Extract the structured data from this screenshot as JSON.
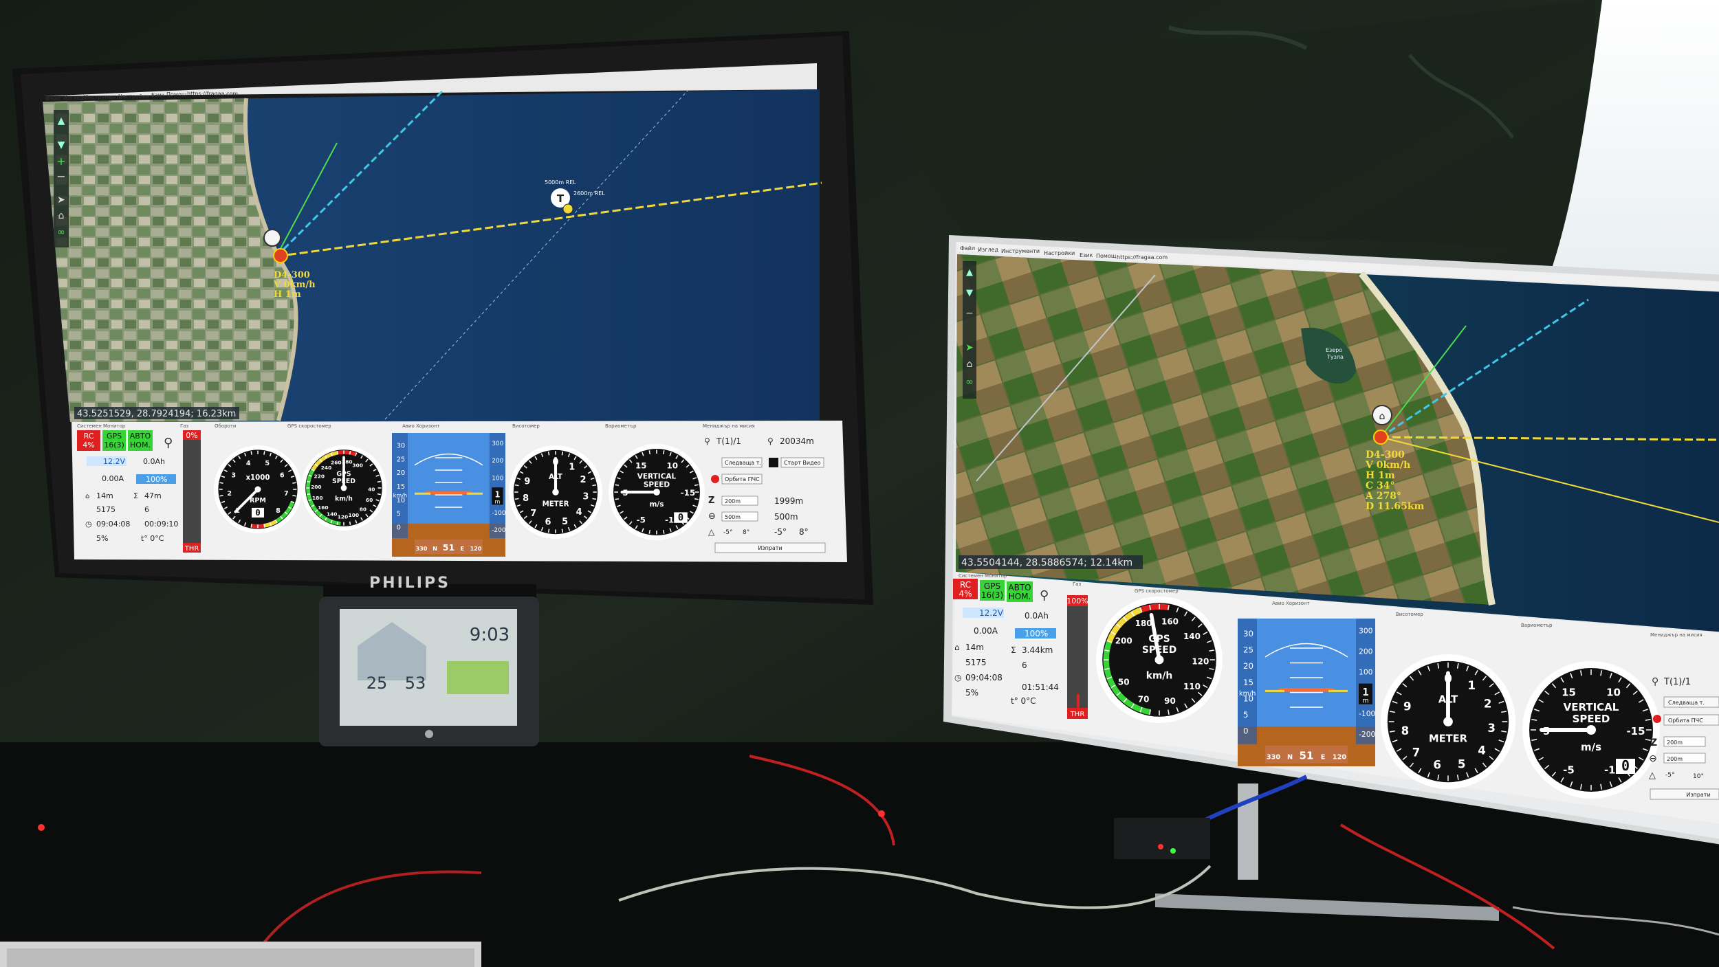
{
  "left_monitor": {
    "brand": "PHILIPS",
    "menu": [
      "Файл",
      "Изглед",
      "Инструменти",
      "Настройки",
      "Език",
      "Помощ",
      "https://fragaa.com"
    ],
    "coords": "43.5251529, 28.7924194; 16.23km",
    "waypoint_label_1": "5000m REL",
    "waypoint_label_2": "2600m REL",
    "drone_label": {
      "id": "D4-300",
      "v": "V 0km/h",
      "h": "H 1m"
    },
    "panel_titles": {
      "monitor": "Системен Монитор",
      "gas": "Газ",
      "rpm": "Обороти",
      "gps": "GPS скоростомер",
      "horizon": "Авио Хоризонт",
      "alt": "Висотомер",
      "vario": "Вариометър",
      "mission": "Мениджър на мисия"
    },
    "status": {
      "rc": [
        "RC",
        "4%"
      ],
      "gps": [
        "GPS",
        "16(3)"
      ],
      "auto": [
        "АВТО",
        "НОМ."
      ],
      "voltage": "12.2V",
      "capacity": "0.0Ah",
      "current": "0.00A",
      "battery_pct": "100%",
      "home_dist": "14m",
      "total_dist": "47m",
      "alt_total": "5175",
      "count": "6",
      "time": "09:04:08",
      "timer": "00:09:10",
      "pct": "5%",
      "temp": "t° 0°C"
    },
    "throttle": {
      "pct": "0%",
      "label": "THR"
    },
    "rpm_gauge": {
      "scale": "x1000",
      "unit": "RPM",
      "value": "0",
      "ticks": [
        "1",
        "2",
        "3",
        "4",
        "5",
        "6",
        "7",
        "8"
      ]
    },
    "gps_speed_gauge": {
      "title": "GPS\nSPEED",
      "unit": "km/h",
      "ticks": [
        "300",
        "280",
        "260",
        "240",
        "220",
        "200",
        "180",
        "160",
        "140",
        "120",
        "100",
        "80",
        "60",
        "40"
      ]
    },
    "alt_gauge": {
      "title": "ALT",
      "unit": "METER",
      "ticks": [
        "0",
        "1",
        "2",
        "3",
        "4",
        "5",
        "6",
        "7",
        "8",
        "9"
      ]
    },
    "vario_gauge": {
      "title": "VERTICAL\nSPEED",
      "unit": "m/s",
      "value": "0",
      "ticks": [
        "10",
        "15",
        "5",
        "-5",
        "-10",
        "-15"
      ]
    },
    "horizon": {
      "speed_ticks": [
        "30",
        "25",
        "20",
        "15",
        "10",
        "5",
        "0"
      ],
      "alt_ticks": [
        "300",
        "200",
        "100",
        "0",
        "-100",
        "-200"
      ],
      "speed_unit": "km/h",
      "heading": [
        "330",
        "N",
        "51",
        "E",
        "120"
      ],
      "alt_box": "1",
      "alt_unit": "m"
    },
    "mission": {
      "waypoint": "T(1)/1",
      "distance": "20034m",
      "follow_button": "Следваща т.",
      "video_button": "Старт Видео",
      "orbit_button": "Орбита ПЧС",
      "z_field": "200m",
      "z_value": "1999m",
      "r_field": "500m",
      "r_value": "500m",
      "angles": [
        "-5°",
        "8°",
        "-5°",
        "8°"
      ],
      "send_button": "Изпрати"
    }
  },
  "right_monitor": {
    "menu": [
      "Файл",
      "Изглед",
      "Инструменти",
      "Настройки",
      "Език",
      "Помощ",
      "https://fragaa.com"
    ],
    "coords": "43.5504144, 28.5886574; 12.14km",
    "lake_label": [
      "Езеро",
      "Тузла"
    ],
    "drone_label": {
      "id": "D4-300",
      "v": "V 0km/h",
      "h": "H 1m",
      "c": "C 34°",
      "a": "A 278°",
      "d": "D 11.65km"
    },
    "panel_titles": {
      "monitor": "Системен Монитор",
      "gas": "Газ",
      "gps": "GPS скоростомер",
      "horizon": "Авио Хоризонт",
      "alt": "Висотомер",
      "vario": "Вариометър",
      "mission": "Мениджър на мисия"
    },
    "status": {
      "rc": [
        "RC",
        "4%"
      ],
      "gps": [
        "GPS",
        "16(3)"
      ],
      "auto": [
        "АВТО",
        "НОМ."
      ],
      "voltage": "12.2V",
      "capacity": "0.0Ah",
      "current": "0.00A",
      "battery_pct": "100%",
      "home_dist": "14m",
      "total_dist": "3.44km",
      "alt_total": "5175",
      "count": "6",
      "time": "09:04:08",
      "timer": "01:51:44",
      "pct": "5%",
      "temp": "t° 0°C"
    },
    "throttle": {
      "pct": "100%",
      "label": "THR"
    },
    "gps_speed_gauge": {
      "title": "GPS\nSPEED",
      "unit": "km/h",
      "ticks": [
        "200",
        "180",
        "160",
        "140",
        "120",
        "110",
        "90",
        "70",
        "50"
      ]
    },
    "alt_gauge": {
      "title": "ALT",
      "unit": "METER",
      "ticks": [
        "0",
        "1",
        "2",
        "3",
        "4",
        "5",
        "6",
        "7",
        "8",
        "9"
      ]
    },
    "vario_gauge": {
      "title": "VERTICAL\nSPEED",
      "unit": "m/s",
      "value": "0",
      "ticks": [
        "10",
        "15",
        "5",
        "-5",
        "-10",
        "-15"
      ]
    },
    "horizon": {
      "speed_ticks": [
        "30",
        "25",
        "20",
        "15",
        "10",
        "5",
        "0"
      ],
      "alt_ticks": [
        "300",
        "200",
        "100",
        "0",
        "-100",
        "-200"
      ],
      "speed_unit": "km/h",
      "heading": [
        "330",
        "N",
        "51",
        "E",
        "120"
      ],
      "alt_box": "1",
      "alt_unit": "m"
    },
    "mission": {
      "waypoint": "T(1)/1",
      "follow_button": "Следваща т.",
      "orbit_button": "Орбита ПЧС",
      "z_field": "200m",
      "r_field": "200m",
      "angles": [
        "-5°",
        "10°"
      ],
      "send_button": "Изпрати"
    }
  },
  "weather_station": {
    "time": "9:03",
    "temp": "25",
    "humidity": "53"
  },
  "colors": {
    "sea": "#1b3f6a",
    "gps_green": "#36d436",
    "rc_red": "#e02020",
    "horizon_sky": "#4a90e2",
    "horizon_ground": "#b5651d",
    "route_yellow": "#f2d93a",
    "route_cyan": "#40c8e8",
    "heading_green": "#4cdc4c"
  }
}
